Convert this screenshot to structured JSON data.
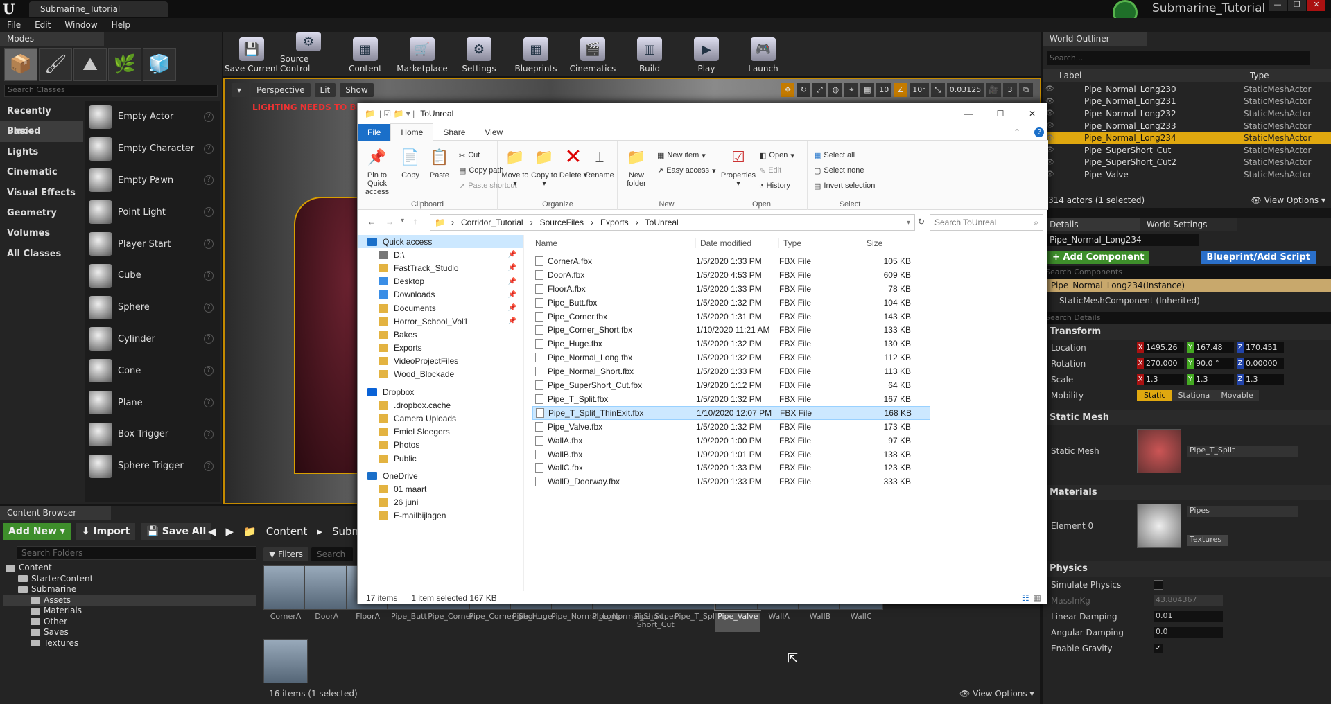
{
  "app": {
    "tab_title": "Submarine_Tutorial",
    "project_name": "Submarine_Tutorial"
  },
  "menu": [
    "File",
    "Edit",
    "Window",
    "Help"
  ],
  "modes": {
    "tab": "Modes",
    "search_placeholder": "Search Classes",
    "categories": [
      "Recently Placed",
      "Basic",
      "Lights",
      "Cinematic",
      "Visual Effects",
      "Geometry",
      "Volumes",
      "All Classes"
    ],
    "selected_category": "Basic",
    "items": [
      "Empty Actor",
      "Empty Character",
      "Empty Pawn",
      "Point Light",
      "Player Start",
      "Cube",
      "Sphere",
      "Cylinder",
      "Cone",
      "Plane",
      "Box Trigger",
      "Sphere Trigger"
    ]
  },
  "toolbar": [
    "Save Current",
    "Source Control",
    "Content",
    "Marketplace",
    "Settings",
    "Blueprints",
    "Cinematics",
    "Build",
    "Play",
    "Launch"
  ],
  "viewport": {
    "buttons": [
      "Perspective",
      "Lit",
      "Show"
    ],
    "warning": "LIGHTING NEEDS TO BE R",
    "grid": "10",
    "angle": "10°",
    "scale": "0.03125",
    "cam_speed": "3"
  },
  "content_browser": {
    "tab": "Content Browser",
    "add_new": "Add New",
    "import": "Import",
    "save_all": "Save All",
    "path": [
      "Content",
      "Subma"
    ],
    "folder_search": "Search Folders",
    "filters": "Filters",
    "asset_search": "Search Ass",
    "tree": [
      {
        "label": "Content",
        "level": 0
      },
      {
        "label": "StarterContent",
        "level": 1
      },
      {
        "label": "Submarine",
        "level": 1
      },
      {
        "label": "Assets",
        "level": 2,
        "selected": true
      },
      {
        "label": "Materials",
        "level": 2
      },
      {
        "label": "Other",
        "level": 2
      },
      {
        "label": "Saves",
        "level": 2
      },
      {
        "label": "Textures",
        "level": 2
      }
    ],
    "assets": [
      "CornerA",
      "DoorA",
      "FloorA",
      "Pipe_Butt",
      "Pipe_Corner",
      "Pipe_Corner_Short",
      "Pipe_Huge",
      "Pipe_Normal_Long",
      "Pipe_Normal_Short",
      "Pipe_Super Short_Cut",
      "Pipe_T_Split",
      "Pipe_Valve",
      "WallA",
      "WallB",
      "WallC"
    ],
    "selected_asset": "Pipe_Valve",
    "status": "16 items (1 selected)",
    "view_options": "View Options"
  },
  "outliner": {
    "tab": "World Outliner",
    "search_placeholder": "Search...",
    "col_label": "Label",
    "col_type": "Type",
    "rows": [
      {
        "label": "Pipe_Normal_Long230",
        "type": "StaticMeshActor"
      },
      {
        "label": "Pipe_Normal_Long231",
        "type": "StaticMeshActor"
      },
      {
        "label": "Pipe_Normal_Long232",
        "type": "StaticMeshActor"
      },
      {
        "label": "Pipe_Normal_Long233",
        "type": "StaticMeshActor"
      },
      {
        "label": "Pipe_Normal_Long234",
        "type": "StaticMeshActor",
        "selected": true
      },
      {
        "label": "Pipe_SuperShort_Cut",
        "type": "StaticMeshActor"
      },
      {
        "label": "Pipe_SuperShort_Cut2",
        "type": "StaticMeshActor"
      },
      {
        "label": "Pipe_Valve",
        "type": "StaticMeshActor"
      }
    ],
    "footer": "314 actors (1 selected)",
    "view_options": "View Options"
  },
  "details": {
    "tab": "Details",
    "tab2": "World Settings",
    "name": "Pipe_Normal_Long234",
    "add_component": "+ Add Component",
    "blueprint": "Blueprint/Add Script",
    "search_components": "Search Components",
    "instance": "Pipe_Normal_Long234(Instance)",
    "component": "StaticMeshComponent (Inherited)",
    "search_details": "Search Details",
    "transform": "Transform",
    "location_label": "Location",
    "location": [
      "1495.26",
      "167.48",
      "170.451"
    ],
    "rotation_label": "Rotation",
    "rotation": [
      "270.000",
      "90.0 °",
      "0.00000"
    ],
    "scale_label": "Scale",
    "scale": [
      "1.3",
      "1.3",
      "1.3"
    ],
    "mobility_label": "Mobility",
    "mobility": [
      "Static",
      "Stationa",
      "Movable"
    ],
    "static_mesh_section": "Static Mesh",
    "static_mesh_label": "Static Mesh",
    "static_mesh": "Pipe_T_Split",
    "materials_section": "Materials",
    "element0": "Element 0",
    "material": "Pipes",
    "textures": "Textures",
    "physics": "Physics",
    "simulate": "Simulate Physics",
    "mass": "MassInKg",
    "mass_val": "43.804367",
    "linear": "Linear Damping",
    "linear_val": "0.01",
    "angular": "Angular Damping",
    "angular_val": "0.0",
    "gravity": "Enable Gravity"
  },
  "explorer": {
    "title": "ToUnreal",
    "tabs": [
      "File",
      "Home",
      "Share",
      "View"
    ],
    "clipboard": {
      "pin": "Pin to Quick access",
      "copy": "Copy",
      "paste": "Paste",
      "cut": "Cut",
      "copy_path": "Copy path",
      "paste_shortcut": "Paste shortcut",
      "group": "Clipboard"
    },
    "organize": {
      "move": "Move to",
      "copy": "Copy to",
      "delete": "Delete",
      "rename": "Rename",
      "group": "Organize"
    },
    "new": {
      "folder": "New folder",
      "item": "New item",
      "easy": "Easy access",
      "group": "New"
    },
    "open": {
      "props": "Properties",
      "open": "Open",
      "edit": "Edit",
      "history": "History",
      "group": "Open"
    },
    "select": {
      "all": "Select all",
      "none": "Select none",
      "invert": "Invert selection",
      "group": "Select"
    },
    "path": [
      "Corridor_Tutorial",
      "SourceFiles",
      "Exports",
      "ToUnreal"
    ],
    "search_placeholder": "Search ToUnreal",
    "nav": [
      {
        "label": "Quick access",
        "kind": "star",
        "level": 0
      },
      {
        "label": "D:\\",
        "kind": "drive",
        "level": 1,
        "pin": true
      },
      {
        "label": "FastTrack_Studio",
        "kind": "folder",
        "level": 1,
        "pin": true
      },
      {
        "label": "Desktop",
        "kind": "blue",
        "level": 1,
        "pin": true
      },
      {
        "label": "Downloads",
        "kind": "blue",
        "level": 1,
        "pin": true
      },
      {
        "label": "Documents",
        "kind": "folder",
        "level": 1,
        "pin": true
      },
      {
        "label": "Horror_School_Vol1",
        "kind": "folder",
        "level": 1,
        "pin": true
      },
      {
        "label": "Bakes",
        "kind": "folder",
        "level": 1
      },
      {
        "label": "Exports",
        "kind": "folder",
        "level": 1
      },
      {
        "label": "VideoProjectFiles",
        "kind": "folder",
        "level": 1
      },
      {
        "label": "Wood_Blockade",
        "kind": "folder",
        "level": 1
      },
      {
        "label": "",
        "kind": "gap",
        "level": 0
      },
      {
        "label": "Dropbox",
        "kind": "dropbox",
        "level": 0
      },
      {
        "label": ".dropbox.cache",
        "kind": "folder",
        "level": 1
      },
      {
        "label": "Camera Uploads",
        "kind": "folder",
        "level": 1
      },
      {
        "label": "Emiel Sleegers",
        "kind": "folder",
        "level": 1
      },
      {
        "label": "Photos",
        "kind": "folder",
        "level": 1
      },
      {
        "label": "Public",
        "kind": "folder",
        "level": 1
      },
      {
        "label": "",
        "kind": "gap",
        "level": 0
      },
      {
        "label": "OneDrive",
        "kind": "cloud",
        "level": 0
      },
      {
        "label": "01 maart",
        "kind": "folder",
        "level": 1
      },
      {
        "label": "26 juni",
        "kind": "folder",
        "level": 1
      },
      {
        "label": "E-mailbijlagen",
        "kind": "folder",
        "level": 1
      }
    ],
    "columns": [
      "Name",
      "Date modified",
      "Type",
      "Size"
    ],
    "files": [
      {
        "name": "CornerA.fbx",
        "date": "1/5/2020 1:33 PM",
        "type": "FBX File",
        "size": "105 KB"
      },
      {
        "name": "DoorA.fbx",
        "date": "1/5/2020 4:53 PM",
        "type": "FBX File",
        "size": "609 KB"
      },
      {
        "name": "FloorA.fbx",
        "date": "1/5/2020 1:33 PM",
        "type": "FBX File",
        "size": "78 KB"
      },
      {
        "name": "Pipe_Butt.fbx",
        "date": "1/5/2020 1:32 PM",
        "type": "FBX File",
        "size": "104 KB"
      },
      {
        "name": "Pipe_Corner.fbx",
        "date": "1/5/2020 1:31 PM",
        "type": "FBX File",
        "size": "143 KB"
      },
      {
        "name": "Pipe_Corner_Short.fbx",
        "date": "1/10/2020 11:21 AM",
        "type": "FBX File",
        "size": "133 KB"
      },
      {
        "name": "Pipe_Huge.fbx",
        "date": "1/5/2020 1:32 PM",
        "type": "FBX File",
        "size": "130 KB"
      },
      {
        "name": "Pipe_Normal_Long.fbx",
        "date": "1/5/2020 1:32 PM",
        "type": "FBX File",
        "size": "112 KB"
      },
      {
        "name": "Pipe_Normal_Short.fbx",
        "date": "1/5/2020 1:33 PM",
        "type": "FBX File",
        "size": "113 KB"
      },
      {
        "name": "Pipe_SuperShort_Cut.fbx",
        "date": "1/9/2020 1:12 PM",
        "type": "FBX File",
        "size": "64 KB"
      },
      {
        "name": "Pipe_T_Split.fbx",
        "date": "1/5/2020 1:32 PM",
        "type": "FBX File",
        "size": "167 KB"
      },
      {
        "name": "Pipe_T_Split_ThinExit.fbx",
        "date": "1/10/2020 12:07 PM",
        "type": "FBX File",
        "size": "168 KB",
        "selected": true
      },
      {
        "name": "Pipe_Valve.fbx",
        "date": "1/5/2020 1:32 PM",
        "type": "FBX File",
        "size": "173 KB"
      },
      {
        "name": "WallA.fbx",
        "date": "1/9/2020 1:00 PM",
        "type": "FBX File",
        "size": "97 KB"
      },
      {
        "name": "WallB.fbx",
        "date": "1/9/2020 1:01 PM",
        "type": "FBX File",
        "size": "138 KB"
      },
      {
        "name": "WallC.fbx",
        "date": "1/5/2020 1:33 PM",
        "type": "FBX File",
        "size": "123 KB"
      },
      {
        "name": "WallD_Doorway.fbx",
        "date": "1/5/2020 1:33 PM",
        "type": "FBX File",
        "size": "333 KB"
      }
    ],
    "status_items": "17 items",
    "status_selected": "1 item selected  167 KB"
  }
}
